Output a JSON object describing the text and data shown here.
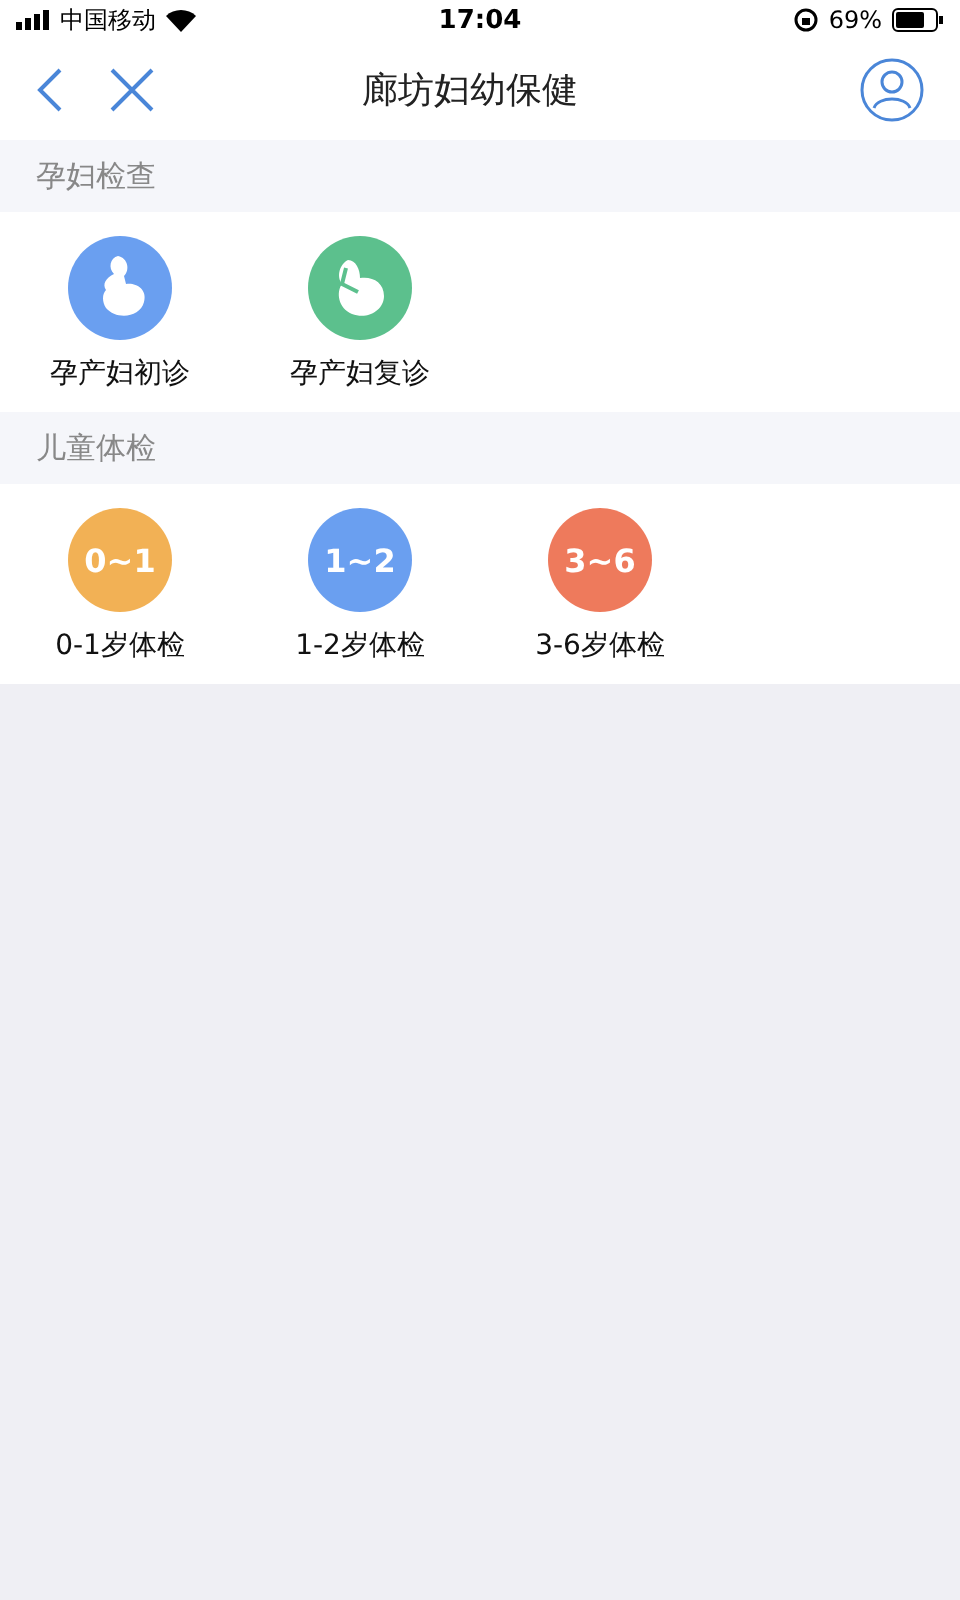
{
  "status_bar": {
    "carrier": "中国移动",
    "time": "17:04",
    "battery": "69%"
  },
  "nav": {
    "title": "廊坊妇幼保健"
  },
  "sections": [
    {
      "title": "孕妇检查",
      "items": [
        {
          "kind": "pregnant",
          "label": "孕产妇初诊",
          "color": "#6a9ff0"
        },
        {
          "kind": "belly",
          "label": "孕产妇复诊",
          "color": "#5cc08d"
        }
      ]
    },
    {
      "title": "儿童体检",
      "items": [
        {
          "kind": "text",
          "badge": "0~1",
          "label": "0-1岁体检",
          "color": "#f2b155"
        },
        {
          "kind": "text",
          "badge": "1~2",
          "label": "1-2岁体检",
          "color": "#6a9ff0"
        },
        {
          "kind": "text",
          "badge": "3~6",
          "label": "3-6岁体检",
          "color": "#ee7a5c"
        }
      ]
    }
  ]
}
